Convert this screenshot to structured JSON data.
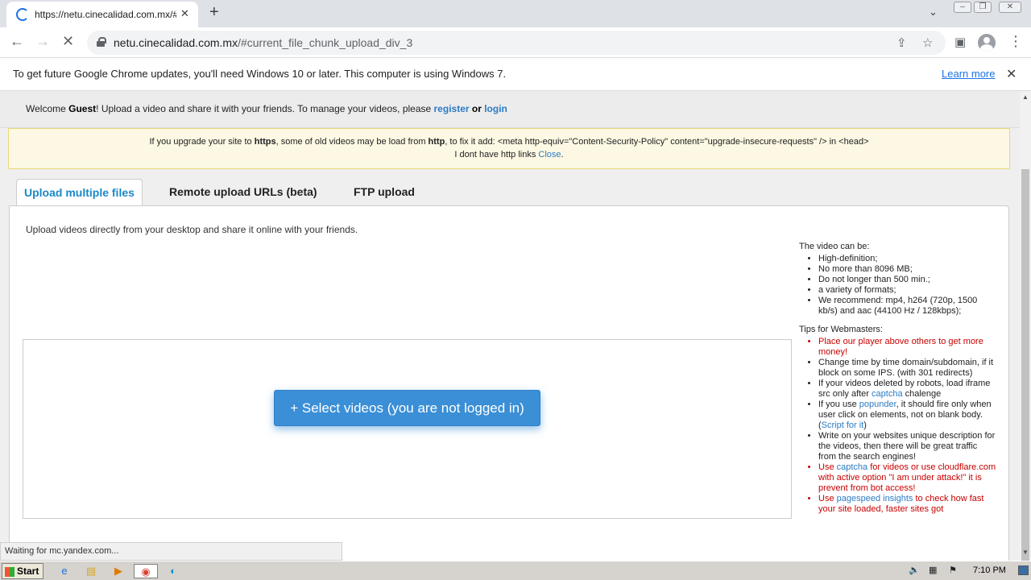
{
  "browser": {
    "tab_title": "https://netu.cinecalidad.com.mx/#c",
    "tab_close": "✕",
    "new_tab": "+",
    "tab_search": "⌄",
    "url_host": "netu.cinecalidad.com.mx",
    "url_path": "/#current_file_chunk_upload_div_3",
    "back": "←",
    "forward": "→",
    "stop": "✕",
    "share": "⇪",
    "star": "☆",
    "sidepanel": "▣",
    "menu": "⋮",
    "win_min": "–",
    "win_max": "❐",
    "win_close": "✕"
  },
  "infobar": {
    "text": "To get future Google Chrome updates, you'll need Windows 10 or later. This computer is using Windows 7.",
    "link": "Learn more",
    "close": "✕"
  },
  "welcome": {
    "prefix": "Welcome ",
    "user": "Guest",
    "middle": "! Upload a video and share it with your friends. To manage your videos, please ",
    "register": "register",
    "or": " or ",
    "login": "login"
  },
  "notice": {
    "l1a": "If you upgrade your site to ",
    "l1b": "https",
    "l1c": ", some of old videos may be load from ",
    "l1d": "http",
    "l1e": ", to fix it add: <meta http-equiv=\"Content-Security-Policy\" content=\"upgrade-insecure-requests\" /> in <head>",
    "l2": "I dont have http links ",
    "close": "Close",
    "dot": "."
  },
  "tabs": [
    "Upload multiple files",
    "Remote upload URLs (beta)",
    "FTP upload"
  ],
  "lead": "Upload videos directly from your desktop and share it online with your friends.",
  "select_button": "+ Select videos (you are not logged in)",
  "video_can_be": {
    "heading": "The video can be:",
    "items": [
      "High-definition;",
      "No more than 8096 MB;",
      "Do not longer than 500 min.;",
      "a variety of formats;",
      "We recommend: mp4, h264 (720p, 1500 kb/s) and aac (44100 Hz / 128kbps);"
    ]
  },
  "tips": {
    "heading": "Tips for Webmasters:",
    "t1": "Place our player above others to get more money!",
    "t2": "Change time by time domain/subdomain, if it block on some IPS. (with 301 redirects)",
    "t3a": "If your videos deleted by robots, load iframe src only after ",
    "t3link": "captcha",
    "t3b": " chalenge",
    "t4a": "If you use ",
    "t4link": "popunder",
    "t4b": ", it should fire only when user click on elements, not on blank body. (",
    "t4link2": "Script for it",
    "t4c": ")",
    "t5": "Write on your websites unique description for the videos, then there will be great traffic from the search engines!",
    "t6a": "Use ",
    "t6link": "captcha",
    "t6b": " for videos or use cloudflare.com with active option \"I am under attack!\" it is prevent from bot access!",
    "t7a": "Use ",
    "t7link": "pagespeed insights",
    "t7b": " to check how fast your site loaded, faster sites got"
  },
  "status_text": "Waiting for mc.yandex.com...",
  "taskbar": {
    "start": "Start",
    "clock": "7:10 PM"
  }
}
